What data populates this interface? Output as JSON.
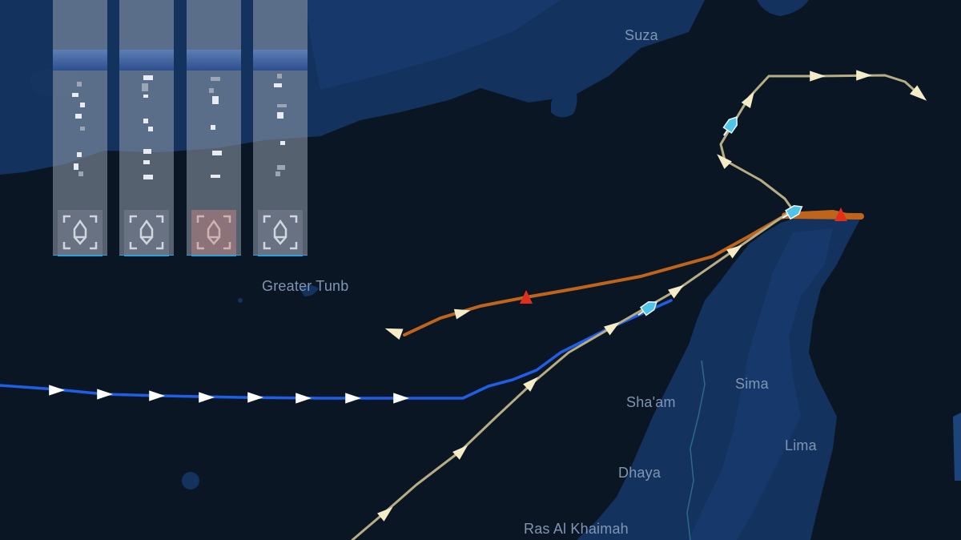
{
  "map": {
    "colors": {
      "sea": "#0b1624",
      "land": "#13325e",
      "land_detail": "#16386a",
      "route_blue": "#1f5ee6",
      "route_orange": "#c0641c",
      "route_tan": "#b6ad82",
      "arrow_white": "#ffffff",
      "arrow_cream": "#f3ecc6",
      "marker_red": "#e0301c",
      "vessel_cyan": "#4fc3e8"
    },
    "places": [
      {
        "id": "suza",
        "name": "Suza"
      },
      {
        "id": "greater-tunb",
        "name": "Greater Tunb"
      },
      {
        "id": "sima",
        "name": "Sima"
      },
      {
        "id": "shaam",
        "name": "Sha'am"
      },
      {
        "id": "lima",
        "name": "Lima"
      },
      {
        "id": "dhaya",
        "name": "Dhaya"
      },
      {
        "id": "ras-al-khaimah",
        "name": "Ras Al Khaimah"
      }
    ],
    "routes": [
      {
        "id": "blue-route",
        "color": "#1f5ee6"
      },
      {
        "id": "orange-route",
        "color": "#c0641c"
      },
      {
        "id": "tan-route",
        "color": "#b6ad82"
      }
    ]
  },
  "panels": [
    {
      "id": "panel-1",
      "icon": "ship-locate-icon",
      "active": false
    },
    {
      "id": "panel-2",
      "icon": "ship-locate-icon",
      "active": false
    },
    {
      "id": "panel-3",
      "icon": "ship-locate-icon",
      "active": true
    },
    {
      "id": "panel-4",
      "icon": "ship-locate-icon",
      "active": false
    }
  ]
}
